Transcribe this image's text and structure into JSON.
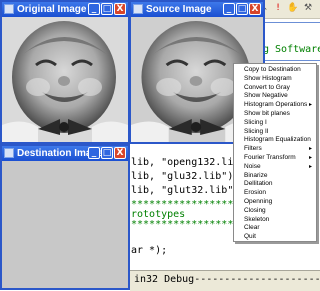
{
  "windows": {
    "original": {
      "title": "Original Image"
    },
    "source": {
      "title": "Source Image"
    },
    "destination": {
      "title": "Destination Image"
    }
  },
  "title_buttons": {
    "minimize": "_",
    "maximize": "□",
    "close": "X"
  },
  "ide": {
    "code_lines": [
      {
        "text": "g Software"
      },
      {
        "text": "lib, \"openg132.lib\")  // Li"
      },
      {
        "text": "lib, \"glu32.lib\")    // Li"
      },
      {
        "text": "lib, \"glut32.lib\")   // Li"
      },
      {
        "text": "****************************"
      },
      {
        "text": "rototypes"
      },
      {
        "text": "****************************"
      },
      {
        "text": "ar *);"
      },
      {
        "text": "in32 Debug----------------------"
      }
    ],
    "toolbar_icons": [
      "toolbar-pointer-icon",
      "toolbar-exclamation-icon",
      "toolbar-hand-icon",
      "toolbar-tools-icon"
    ]
  },
  "context_menu": {
    "items": [
      {
        "label": "Copy to Destination",
        "submenu": false
      },
      {
        "label": "Show Histogram",
        "submenu": false
      },
      {
        "label": "Convert to Gray",
        "submenu": false
      },
      {
        "label": "Show Negative",
        "submenu": false
      },
      {
        "label": "Histogram Operations",
        "submenu": true
      },
      {
        "label": "Show bit planes",
        "submenu": false
      },
      {
        "label": "Slicing I",
        "submenu": false
      },
      {
        "label": "Slicing II",
        "submenu": false
      },
      {
        "label": "Histogram Equalization",
        "submenu": false
      },
      {
        "label": "Filters",
        "submenu": true
      },
      {
        "label": "Fourier Transform",
        "submenu": true
      },
      {
        "label": "Noise",
        "submenu": true
      },
      {
        "label": "Binarize",
        "submenu": false
      },
      {
        "label": "Dellitation",
        "submenu": false
      },
      {
        "label": "Erosion",
        "submenu": false
      },
      {
        "label": "Openning",
        "submenu": false
      },
      {
        "label": "Closing",
        "submenu": false
      },
      {
        "label": "Skeleton",
        "submenu": false
      },
      {
        "label": "Clear",
        "submenu": false
      },
      {
        "label": "Quit",
        "submenu": false
      }
    ],
    "submenu_arrow": "▸"
  }
}
